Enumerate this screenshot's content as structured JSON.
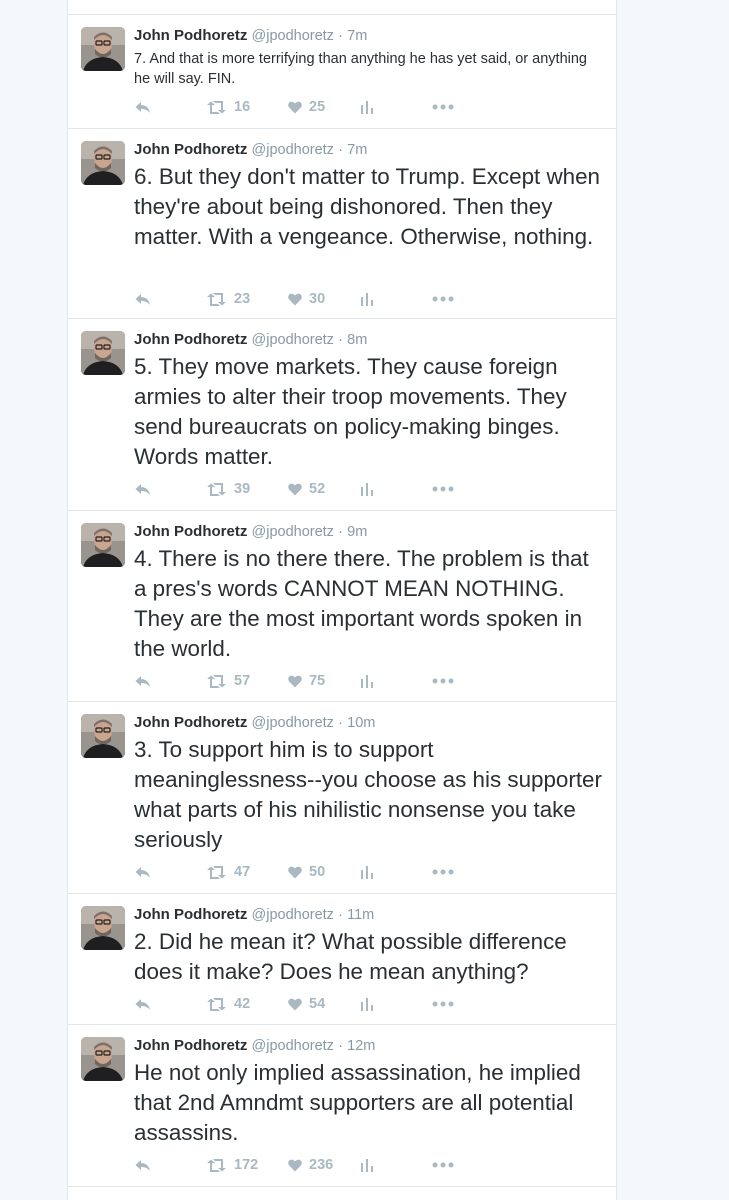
{
  "tweets": [
    {
      "name": "John Podhoretz",
      "handle": "@jpodhoretz",
      "separator": "·",
      "time": "7m",
      "text": "7. And that is more terrifying than anything he has yet said, or anything he will say. FIN.",
      "retweets": "16",
      "likes": "25"
    },
    {
      "name": "John Podhoretz",
      "handle": "@jpodhoretz",
      "separator": "·",
      "time": "7m",
      "text": "6. But they don't matter to Trump. Except when they're about being dishonored. Then they matter. With a vengeance. Otherwise, nothing.",
      "retweets": "23",
      "likes": "30"
    },
    {
      "name": "John Podhoretz",
      "handle": "@jpodhoretz",
      "separator": "·",
      "time": "8m",
      "text": "5. They move markets. They cause foreign armies to alter their troop movements. They send bureaucrats on policy-making binges. Words matter.",
      "retweets": "39",
      "likes": "52"
    },
    {
      "name": "John Podhoretz",
      "handle": "@jpodhoretz",
      "separator": "·",
      "time": "9m",
      "text": "4. There is no there there. The problem is that a pres's words CANNOT MEAN NOTHING. They are the most important words spoken in the world.",
      "retweets": "57",
      "likes": "75"
    },
    {
      "name": "John Podhoretz",
      "handle": "@jpodhoretz",
      "separator": "·",
      "time": "10m",
      "text": "3. To support him is to support meaninglessness--you choose as his supporter what parts of his nihilistic nonsense you take seriously",
      "retweets": "47",
      "likes": "50"
    },
    {
      "name": "John Podhoretz",
      "handle": "@jpodhoretz",
      "separator": "·",
      "time": "11m",
      "text": "2. Did he mean it? What possible difference does it make? Does he mean anything?",
      "retweets": "42",
      "likes": "54"
    },
    {
      "name": "John Podhoretz",
      "handle": "@jpodhoretz",
      "separator": "·",
      "time": "12m",
      "text": "He not only implied assassination, he implied that 2nd Amndmt supporters are all potential assassins.",
      "retweets": "172",
      "likes": "236"
    }
  ],
  "icons": {
    "reply": "reply-icon",
    "retweet": "retweet-icon",
    "like": "heart-icon",
    "analytics": "analytics-icon",
    "more": "more-dots-icon"
  },
  "colors": {
    "text": "#292f33",
    "secondary": "#8899a6",
    "action": "#aab8c2",
    "border": "#e1e8ed",
    "page_background": "#f5f8fa"
  }
}
